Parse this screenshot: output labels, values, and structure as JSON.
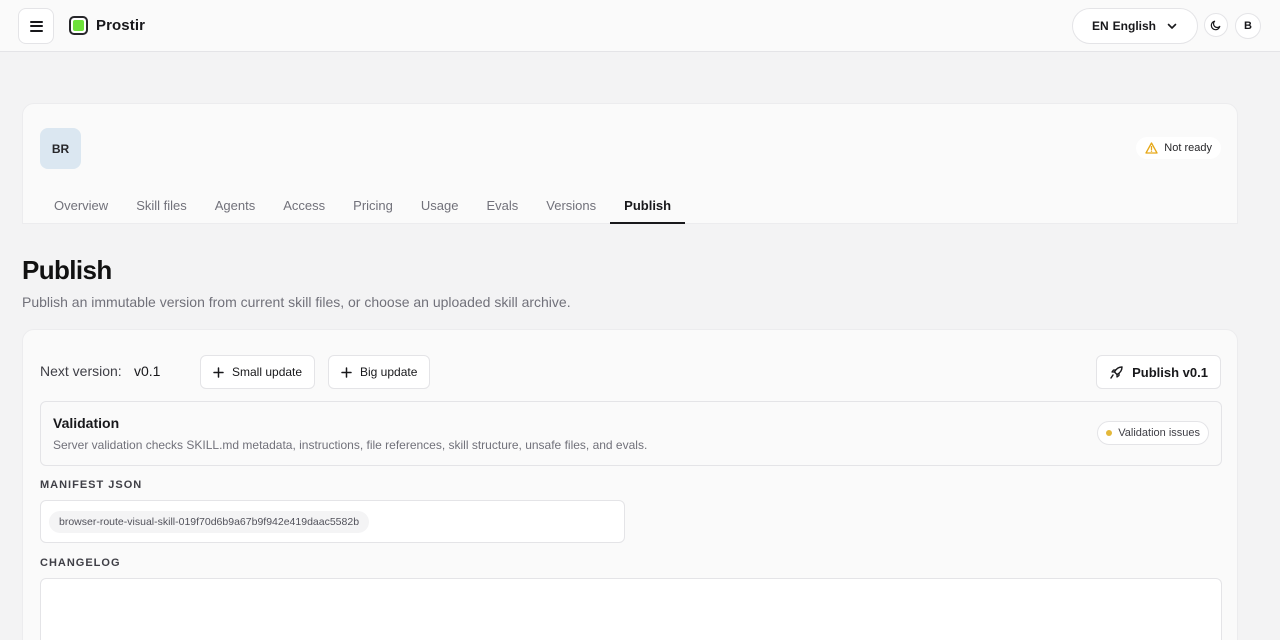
{
  "topbar": {
    "brand_name": "Prostir",
    "language_code": "EN",
    "language_name": "English",
    "user_initial": "B",
    "icons": {
      "menu": "hamburger-icon",
      "brand": "brand-logo-icon",
      "language_dropdown": "chevron-down-icon",
      "theme": "moon-icon"
    }
  },
  "skill": {
    "avatar_initials": "BR",
    "status_label": "Not ready",
    "status_icon": "warning-triangle-icon",
    "status_color": "#e6a817"
  },
  "tabs": [
    {
      "label": "Overview",
      "active": false
    },
    {
      "label": "Skill files",
      "active": false
    },
    {
      "label": "Agents",
      "active": false
    },
    {
      "label": "Access",
      "active": false
    },
    {
      "label": "Pricing",
      "active": false
    },
    {
      "label": "Usage",
      "active": false
    },
    {
      "label": "Evals",
      "active": false
    },
    {
      "label": "Versions",
      "active": false
    },
    {
      "label": "Publish",
      "active": true
    }
  ],
  "page": {
    "title": "Publish",
    "subtitle": "Publish an immutable version from current skill files, or choose an uploaded skill archive."
  },
  "publish": {
    "next_version_label": "Next version:",
    "next_version_value": "v0.1",
    "small_update_label": "Small update",
    "big_update_label": "Big update",
    "publish_button_label": "Publish v0.1",
    "publish_icon": "rocket-icon"
  },
  "validation": {
    "title": "Validation",
    "description": "Server validation checks SKILL.md metadata, instructions, file references, skill structure, unsafe files, and evals.",
    "status_label": "Validation issues",
    "status_color": "#e4b83a"
  },
  "manifest": {
    "label": "MANIFEST JSON",
    "chip_value": "browser-route-visual-skill-019f70d6b9a67b9f942e419daac5582b"
  },
  "changelog": {
    "label": "CHANGELOG",
    "value": ""
  }
}
